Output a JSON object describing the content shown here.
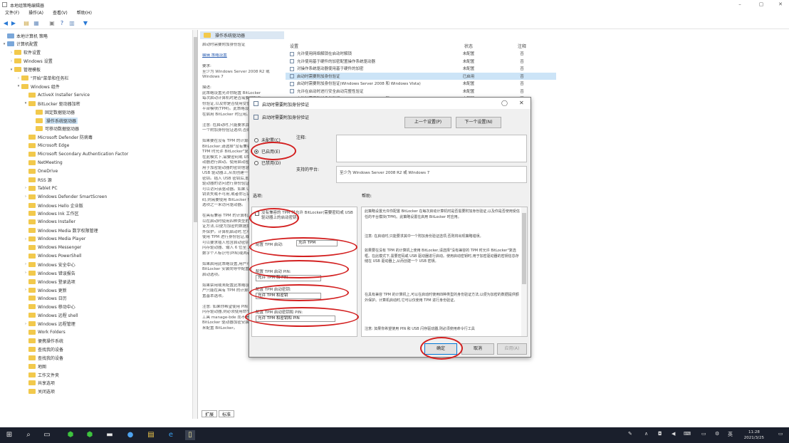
{
  "window": {
    "title": "本地组策略编辑器",
    "min": "–",
    "max": "▢",
    "close": "✕"
  },
  "menu": [
    "文件(F)",
    "操作(A)",
    "查看(V)",
    "帮助(H)"
  ],
  "tree": {
    "items": [
      {
        "label": "本地计算机 策略",
        "level": 0,
        "expander": "",
        "icon": "root"
      },
      {
        "label": "计算机配置",
        "level": 0,
        "expander": "▾",
        "icon": "root"
      },
      {
        "label": "软件设置",
        "level": 1,
        "expander": "›",
        "icon": "folder"
      },
      {
        "label": "Windows 设置",
        "level": 1,
        "expander": "›",
        "icon": "folder"
      },
      {
        "label": "管理模板",
        "level": 1,
        "expander": "▾",
        "icon": "folder"
      },
      {
        "label": "\"开始\"菜单和任务栏",
        "level": 2,
        "expander": "›",
        "icon": "folder"
      },
      {
        "label": "Windows 组件",
        "level": 2,
        "expander": "▾",
        "icon": "folder"
      },
      {
        "label": "ActiveX Installer Service",
        "level": 3,
        "expander": "",
        "icon": "folder"
      },
      {
        "label": "BitLocker 驱动器加密",
        "level": 3,
        "expander": "▾",
        "icon": "folder"
      },
      {
        "label": "固定数据驱动器",
        "level": 4,
        "expander": "",
        "icon": "folder"
      },
      {
        "label": "操作系统驱动器",
        "level": 4,
        "expander": "",
        "icon": "folder",
        "selected": true
      },
      {
        "label": "可移动数据驱动器",
        "level": 4,
        "expander": "",
        "icon": "folder"
      },
      {
        "label": "Microsoft Defender 防病毒",
        "level": 3,
        "expander": "",
        "icon": "folder"
      },
      {
        "label": "Microsoft Edge",
        "level": 3,
        "expander": "",
        "icon": "folder"
      },
      {
        "label": "Microsoft Secondary Authentication Factor",
        "level": 3,
        "expander": "",
        "icon": "folder"
      },
      {
        "label": "NetMeeting",
        "level": 3,
        "expander": "",
        "icon": "folder"
      },
      {
        "label": "OneDrive",
        "level": 3,
        "expander": "",
        "icon": "folder"
      },
      {
        "label": "RSS 源",
        "level": 3,
        "expander": "",
        "icon": "folder"
      },
      {
        "label": "Tablet PC",
        "level": 3,
        "expander": "›",
        "icon": "folder"
      },
      {
        "label": "Windows Defender SmartScreen",
        "level": 3,
        "expander": "›",
        "icon": "folder"
      },
      {
        "label": "Windows Hello 企业版",
        "level": 3,
        "expander": "",
        "icon": "folder"
      },
      {
        "label": "Windows Ink 工作区",
        "level": 3,
        "expander": "",
        "icon": "folder"
      },
      {
        "label": "Windows Installer",
        "level": 3,
        "expander": "",
        "icon": "folder"
      },
      {
        "label": "Windows Media 数字权限管理",
        "level": 3,
        "expander": "",
        "icon": "folder"
      },
      {
        "label": "Windows Media Player",
        "level": 3,
        "expander": "›",
        "icon": "folder"
      },
      {
        "label": "Windows Messenger",
        "level": 3,
        "expander": "",
        "icon": "folder"
      },
      {
        "label": "Windows PowerShell",
        "level": 3,
        "expander": "",
        "icon": "folder"
      },
      {
        "label": "Windows 安全中心",
        "level": 3,
        "expander": "›",
        "icon": "folder"
      },
      {
        "label": "Windows 错误报告",
        "level": 3,
        "expander": "›",
        "icon": "folder"
      },
      {
        "label": "Windows 登录选项",
        "level": 3,
        "expander": "",
        "icon": "folder"
      },
      {
        "label": "Windows 更新",
        "level": 3,
        "expander": "›",
        "icon": "folder"
      },
      {
        "label": "Windows 日历",
        "level": 3,
        "expander": "",
        "icon": "folder"
      },
      {
        "label": "Windows 移动中心",
        "level": 3,
        "expander": "",
        "icon": "folder"
      },
      {
        "label": "Windows 远程 shell",
        "level": 3,
        "expander": "",
        "icon": "folder"
      },
      {
        "label": "Windows 远程管理",
        "level": 3,
        "expander": "›",
        "icon": "folder"
      },
      {
        "label": "Work Folders",
        "level": 3,
        "expander": "",
        "icon": "folder"
      },
      {
        "label": "便携操作系统",
        "level": 3,
        "expander": "",
        "icon": "folder"
      },
      {
        "label": "查找我的设备",
        "level": 3,
        "expander": "",
        "icon": "folder"
      },
      {
        "label": "查找我的设备",
        "level": 3,
        "expander": "",
        "icon": "folder"
      },
      {
        "label": "地图",
        "level": 3,
        "expander": "",
        "icon": "folder"
      },
      {
        "label": "工作文件夹",
        "level": 3,
        "expander": "",
        "icon": "folder"
      },
      {
        "label": "共享选项",
        "level": 3,
        "expander": "",
        "icon": "folder"
      },
      {
        "label": "关闭选项",
        "level": 3,
        "expander": "",
        "icon": "folder"
      }
    ]
  },
  "right_panel": {
    "header": "操作系统驱动器",
    "desc_lines": [
      "启动时需要附加身份验证",
      "",
      "编辑 策略设置",
      "",
      "要求:",
      "至少为 Windows Server 2008 R2 或",
      "Windows 7",
      "",
      "描述:",
      "此策略设置允许你配置 BitLocker",
      "每次启动计算机时是否需要附加身",
      "份验证,以及你是否使用受信任的",
      "平台模块(TPM)。此策略设置",
      "在启用 BitLocker 时应用。",
      "",
      "注意: 在启动时,只能要求其中",
      "一个附加身份验证选项,否则将",
      "",
      "如果要在没有 TPM 的计算机上使用",
      "BitLocker,请选择\"没有兼容的",
      "TPM 时允许 BitLocker\"复选框。",
      "在此模式下,需要密码或 USB 驱",
      "动器进行启动。使用启动密钥时,",
      "用于加密驱动器的密钥信息存储在",
      "USB 驱动器上,从而创建一个 USB",
      "密钥。插入 USB 密钥后,即可对",
      "驱动器的访问进行身份验证,并且",
      "可以访问该驱动器。如果 USB 密",
      "钥丢失或不可用,或者你忘记了密",
      "码,则需要使用 BitLocker 恢复",
      "选项之一来访问驱动器。",
      "",
      "在具有兼容 TPM 的计算机上,可",
      "以在启动时使用四种类型的身份验",
      "证方法,以便为加密的数据提供额",
      "外保护。计算机启动时,它可以仅",
      "使用 TPM 进行身份验证,或者还",
      "可以要求插入包含启动密钥的 USB",
      "闪存驱动器、输入 6 位至 20 位",
      "数字个人标识号(PIN)或两者。",
      "",
      "如果启用此策略设置,用户可以在",
      "BitLocker 安装向导中配置高级",
      "启动选项。",
      "",
      "如果禁用或未配置此策略设置,用",
      "户只能在具有 TPM 的计算机上配",
      "置基本选项。",
      "",
      "注意: 如果你希望使用 PIN 和 USB",
      "闪存驱动器,则必须使用命令行",
      "工具 manage-bde 而不是",
      "BitLocker 驱动器加密安装向导",
      "来配置 BitLocker。"
    ],
    "link_line_index": 2,
    "columns": [
      "设置",
      "状态",
      "注释"
    ],
    "rows": [
      {
        "name": "允许使用网络解锁在启动时解锁",
        "state": "未配置",
        "note": "否"
      },
      {
        "name": "允许使用基于硬件的加密配置操作系统驱动器",
        "state": "未配置",
        "note": "否"
      },
      {
        "name": "对操作系统驱动器使用基于硬件的加密",
        "state": "未配置",
        "note": "否"
      },
      {
        "name": "启动时需要附加身份验证",
        "state": "已启用",
        "note": "否",
        "selected": true
      },
      {
        "name": "启动时需要附加身份验证(Windows Server 2008 和 Windows Vista)",
        "state": "未配置",
        "note": "否"
      },
      {
        "name": "允许在启动时进行安全启动完整性验证",
        "state": "未配置",
        "note": "否"
      },
      {
        "name": "启动时需要附加身份验证(Windows Server 2008 和 Windows Vista)",
        "state": "未配置",
        "note": "否"
      }
    ],
    "tabs": [
      "扩展",
      "标准"
    ]
  },
  "dialog": {
    "title": "启动时需要附加身份验证",
    "policy_name": "启动时需要附加身份验证",
    "prev_button": "上一个设置(P)",
    "next_button": "下一个设置(N)",
    "options": [
      {
        "label": "未配置(C)",
        "checked": false
      },
      {
        "label": "已启用(E)",
        "checked": true
      },
      {
        "label": "已禁用(D)",
        "checked": false
      }
    ],
    "comment_label": "注释:",
    "supported_label": "支持的平台:",
    "supported_value": "至少为 Windows Server 2008 R2 或 Windows 7",
    "options_header": "选项:",
    "help_header": "帮助:",
    "opt_checkbox": "没有兼容的 TPM 时允许 BitLocker(需要密码或 USB 驱动器上的启动密钥)",
    "opt_groups": [
      {
        "label": "配置 TPM 启动:",
        "value": "允许 TPM"
      },
      {
        "label": "配置 TPM 启动 PIN:",
        "value": "允许 TPM 和 PIN"
      },
      {
        "label": "配置 TPM 启动密钥:",
        "value": "允许 TPM 和密钥"
      },
      {
        "label": "配置 TPM 启动密钥和 PIN:",
        "value": "允许 TPM 和密钥和 PIN"
      }
    ],
    "help_paras": [
      "此策略设置允许你配置 BitLocker 在每次启动计算机时是否需要附加身份验证,以及你是否使用受信任的平台模块(TPM)。此策略设置在启用 BitLocker 时应用。",
      "注意: 在启动时,只能要求其中一个附加身份验证选项,否则将出现策略错误。",
      "如果要在没有 TPM 的计算机上使用 BitLocker,请选择\"没有兼容的 TPM 时允许 BitLocker\"复选框。在此模式下,需要密码或 USB 驱动器进行启动。使用启动密钥时,用于加密驱动器的密钥信息存储在 USB 驱动器上,从而创建一个 USB 密钥。",
      "在具有兼容 TPM 的计算机上,可以在启动时使用四种类型的身份验证方法,以便为加密的数据提供额外保护。计算机启动时,它可以仅使用 TPM 进行身份验证。",
      "注意: 如果你希望使用 PIN 和 USB 闪存驱动器,则必须使用命令行工具"
    ],
    "ok": "确定",
    "cancel": "取消",
    "apply": "应用(A)"
  },
  "taskbar": {
    "clock_time": "11:28",
    "clock_date": "2021/3/25"
  },
  "colors": {
    "annotation_red": "#d32020",
    "selection": "#cce4f7",
    "folder": "#f2c94c"
  }
}
